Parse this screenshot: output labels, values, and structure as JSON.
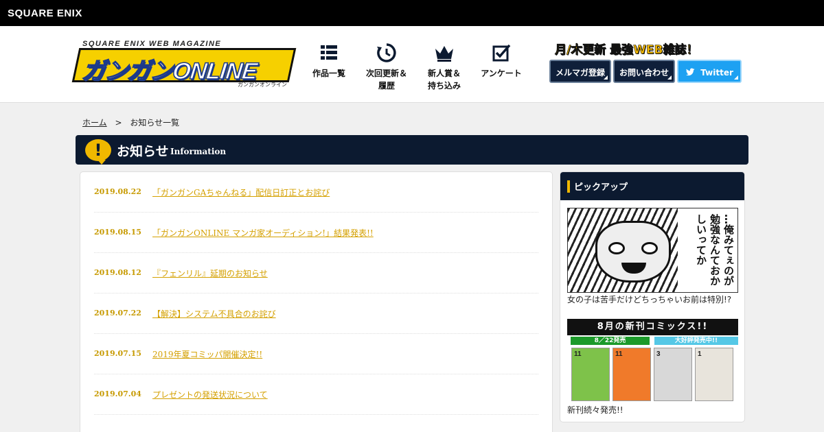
{
  "topbar": {
    "brand": "SQUARE ENIX"
  },
  "logo": {
    "sub": "SQUARE ENIX WEB MAGAZINE",
    "main": "ガンガンONLINE",
    "ruby": "ガンガンオンライン"
  },
  "nav": [
    {
      "label": "作品一覧",
      "icon": "list-grid-icon"
    },
    {
      "label": "次回更新＆\n履歴",
      "icon": "clock-refresh-icon"
    },
    {
      "label": "新人賞＆\n持ち込み",
      "icon": "crown-icon"
    },
    {
      "label": "アンケート",
      "icon": "checkbox-icon"
    }
  ],
  "header": {
    "tagline": "月/木更新 最強WEB雑誌！",
    "buttons": {
      "mailmag": "メルマガ登録",
      "contact": "お問い合わせ",
      "twitter": "Twitter"
    }
  },
  "breadcrumb": {
    "home": "ホーム",
    "sep": ">",
    "current": "お知らせ一覧"
  },
  "section": {
    "title_jp": "お知らせ",
    "title_en": "Information",
    "badge": "!"
  },
  "news": [
    {
      "date": "2019.08.22",
      "title": "「ガンガンGAちゃんねる」配信日訂正とお詫び"
    },
    {
      "date": "2019.08.15",
      "title": "「ガンガンONLINE マンガ家オーディション!」結果発表!!"
    },
    {
      "date": "2019.08.12",
      "title": "『フェンリル』延期のお知らせ"
    },
    {
      "date": "2019.07.22",
      "title": "【解決】システム不具合のお詫び"
    },
    {
      "date": "2019.07.15",
      "title": "2019年夏コミッパ開催決定!!"
    },
    {
      "date": "2019.07.04",
      "title": "プレゼントの発送状況について"
    }
  ],
  "sidebar": {
    "title": "ピックアップ",
    "pick1": {
      "speech": "…俺みてぇのが勉強なんておかしいってか",
      "caption": "女の子は苦手だけどちっちゃいお前は特別!?"
    },
    "pick2": {
      "header": "8月の新刊コミックス!!",
      "tag_a": "8／22発売",
      "tag_b": "大好評発売中!!",
      "covers": [
        {
          "vol": "11",
          "color": "#7ec24a"
        },
        {
          "vol": "11",
          "color": "#f07a2a"
        },
        {
          "vol": "3",
          "color": "#d8d8d8"
        },
        {
          "vol": "1",
          "color": "#e8e4dc"
        }
      ],
      "caption": "新刊続々発売!!"
    }
  },
  "colors": {
    "navy": "#0c1a30",
    "accent": "#f0b800",
    "link": "#d4a000",
    "twitter": "#1da1f2"
  }
}
